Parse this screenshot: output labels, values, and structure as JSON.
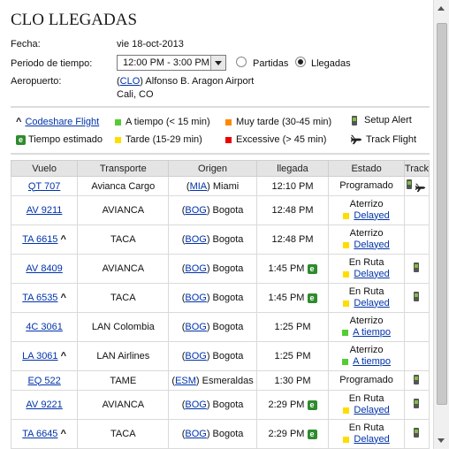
{
  "page": {
    "title": "CLO LLEGADAS",
    "date_label": "Fecha:",
    "date_value": "vie 18-oct-2013",
    "period_label": "Periodo de tiempo:",
    "period_value": "12:00 PM - 3:00 PM",
    "radio_departures": "Partidas",
    "radio_arrivals": "Llegadas",
    "airport_label": "Aeropuerto:",
    "airport_code": "CLO",
    "airport_name": "Alfonso B. Aragon Airport",
    "airport_city": "Cali, CO"
  },
  "legend": {
    "codeshare_symbol": "^",
    "codeshare": "Codeshare Flight",
    "on_time": "A tiempo (< 15 min)",
    "very_late": "Muy tarde (30-45 min)",
    "setup_alert": "Setup Alert",
    "estimated_time": "Tiempo estimado",
    "late": "Tarde (15-29 min)",
    "excessive": "Excessive (> 45 min)",
    "track_flight": "Track Flight",
    "colors": {
      "on_time": "#55cc33",
      "very_late": "#ff8800",
      "late": "#ffdd00",
      "excessive": "#ee0000",
      "estimated": "#2e8b2e"
    }
  },
  "table": {
    "headers": [
      "Vuelo",
      "Transporte",
      "Origen",
      "llegada",
      "Estado",
      "Track"
    ],
    "rows": [
      {
        "flight": "QT 707",
        "codeshare": "",
        "carrier": "Avianca Cargo",
        "orig_code": "MIA",
        "orig_city": "Miami",
        "arrival": "12:10 PM",
        "estimated": false,
        "status1": "Programado",
        "status2": "",
        "status_color": "",
        "phone": true,
        "plane": true
      },
      {
        "flight": "AV 9211",
        "codeshare": "",
        "carrier": "AVIANCA",
        "orig_code": "BOG",
        "orig_city": "Bogota",
        "arrival": "12:48 PM",
        "estimated": false,
        "status1": "Aterrizo",
        "status2": "Delayed",
        "status_color": "#ffdd00",
        "phone": false,
        "plane": false
      },
      {
        "flight": "TA 6615",
        "codeshare": "^",
        "carrier": "TACA",
        "orig_code": "BOG",
        "orig_city": "Bogota",
        "arrival": "12:48 PM",
        "estimated": false,
        "status1": "Aterrizo",
        "status2": "Delayed",
        "status_color": "#ffdd00",
        "phone": false,
        "plane": false
      },
      {
        "flight": "AV 8409",
        "codeshare": "",
        "carrier": "AVIANCA",
        "orig_code": "BOG",
        "orig_city": "Bogota",
        "arrival": "1:45 PM",
        "estimated": true,
        "status1": "En Ruta",
        "status2": "Delayed",
        "status_color": "#ffdd00",
        "phone": true,
        "plane": false
      },
      {
        "flight": "TA 6535",
        "codeshare": "^",
        "carrier": "TACA",
        "orig_code": "BOG",
        "orig_city": "Bogota",
        "arrival": "1:45 PM",
        "estimated": true,
        "status1": "En Ruta",
        "status2": "Delayed",
        "status_color": "#ffdd00",
        "phone": true,
        "plane": false
      },
      {
        "flight": "4C 3061",
        "codeshare": "",
        "carrier": "LAN Colombia",
        "orig_code": "BOG",
        "orig_city": "Bogota",
        "arrival": "1:25 PM",
        "estimated": false,
        "status1": "Aterrizo",
        "status2": "A tiempo",
        "status_color": "#55cc33",
        "phone": false,
        "plane": false
      },
      {
        "flight": "LA 3061",
        "codeshare": "^",
        "carrier": "LAN Airlines",
        "orig_code": "BOG",
        "orig_city": "Bogota",
        "arrival": "1:25 PM",
        "estimated": false,
        "status1": "Aterrizo",
        "status2": "A tiempo",
        "status_color": "#55cc33",
        "phone": false,
        "plane": false
      },
      {
        "flight": "EQ 522",
        "codeshare": "",
        "carrier": "TAME",
        "orig_code": "ESM",
        "orig_city": "Esmeraldas",
        "arrival": "1:30 PM",
        "estimated": false,
        "status1": "Programado",
        "status2": "",
        "status_color": "",
        "phone": true,
        "plane": false
      },
      {
        "flight": "AV 9221",
        "codeshare": "",
        "carrier": "AVIANCA",
        "orig_code": "BOG",
        "orig_city": "Bogota",
        "arrival": "2:29 PM",
        "estimated": true,
        "status1": "En Ruta",
        "status2": "Delayed",
        "status_color": "#ffdd00",
        "phone": true,
        "plane": false
      },
      {
        "flight": "TA 6645",
        "codeshare": "^",
        "carrier": "TACA",
        "orig_code": "BOG",
        "orig_city": "Bogota",
        "arrival": "2:29 PM",
        "estimated": true,
        "status1": "En Ruta",
        "status2": "Delayed",
        "status_color": "#ffdd00",
        "phone": true,
        "plane": false
      }
    ]
  }
}
